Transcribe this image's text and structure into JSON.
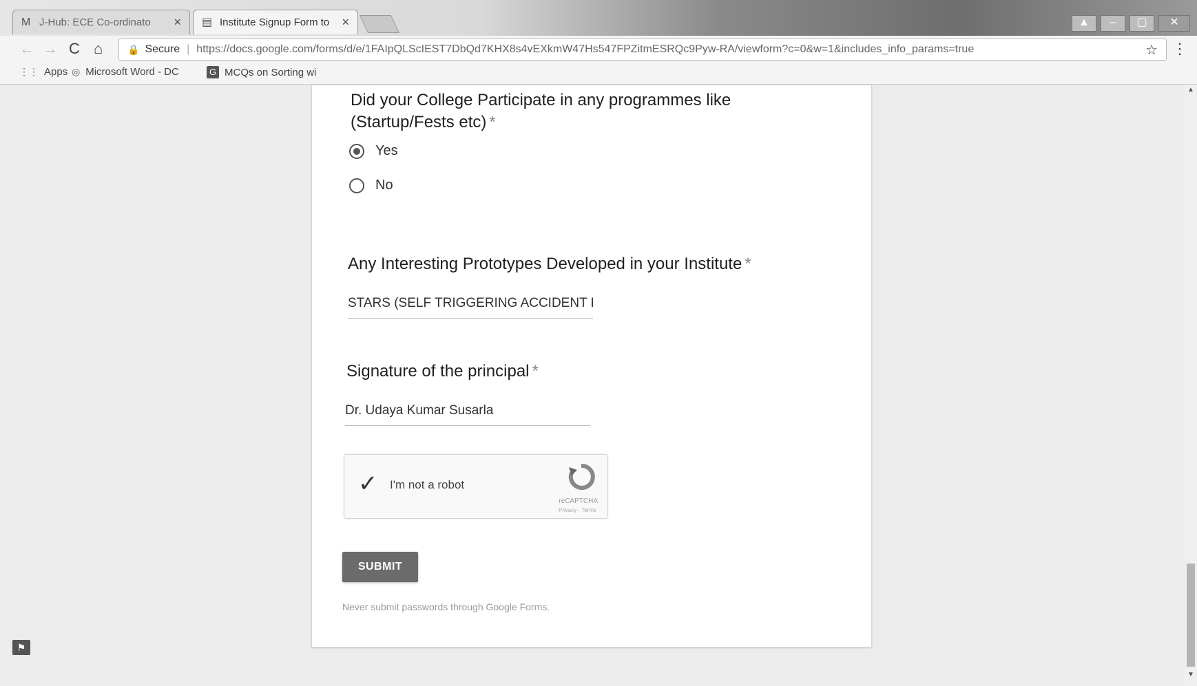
{
  "browser": {
    "tabs": [
      {
        "icon": "gmail-icon",
        "glyph": "M",
        "label": "J-Hub: ECE Co-ordinato",
        "close": "×",
        "active": false
      },
      {
        "icon": "forms-icon",
        "glyph": "▤",
        "label": "Institute Signup Form to",
        "close": "×",
        "active": true
      }
    ],
    "window_buttons": {
      "user": "▲",
      "minimize": "–",
      "maximize": "▢",
      "close": "✕"
    },
    "nav": {
      "back": "←",
      "forward": "→",
      "reload": "C",
      "home": "⌂"
    },
    "address": {
      "secure_label": "Secure",
      "url": "https://docs.google.com/forms/d/e/1FAIpQLScIEST7DbQd7KHX8s4vEXkmW47Hs547FPZitmESRQc9Pyw-RA/viewform?c=0&w=1&includes_info_params=true"
    },
    "bookmarks": [
      {
        "icon": "apps-grid-icon",
        "glyph": "⋮⋮",
        "label": "Apps"
      },
      {
        "icon": "word-doc-icon",
        "glyph": "◎",
        "label": "Microsoft Word - DC"
      },
      {
        "icon": "google-icon",
        "glyph": "G",
        "label": "MCQs on Sorting wi"
      }
    ]
  },
  "form": {
    "q1": {
      "title_line1": "Did your College Participate in any programmes like",
      "title_line2": "(Startup/Fests etc)",
      "required_mark": "*",
      "options": [
        {
          "label": "Yes",
          "selected": true
        },
        {
          "label": "No",
          "selected": false
        }
      ]
    },
    "q2": {
      "title": "Any Interesting Prototypes Developed in your Institute",
      "required_mark": "*",
      "answer": "STARS (SELF TRIGGERING ACCIDENT R"
    },
    "q3": {
      "title": "Signature of the principal",
      "required_mark": "*",
      "answer": "Dr. Udaya Kumar Susarla"
    },
    "captcha": {
      "label": "I'm not a robot",
      "brand": "reCAPTCHA",
      "links": "Privacy - Terms",
      "checked": true
    },
    "submit_label": "SUBMIT",
    "footnote": "Never submit passwords through Google Forms."
  },
  "colors": {
    "submit_bg": "#6b6b6b",
    "page_bg": "#ececec",
    "card_bg": "#ffffff"
  }
}
